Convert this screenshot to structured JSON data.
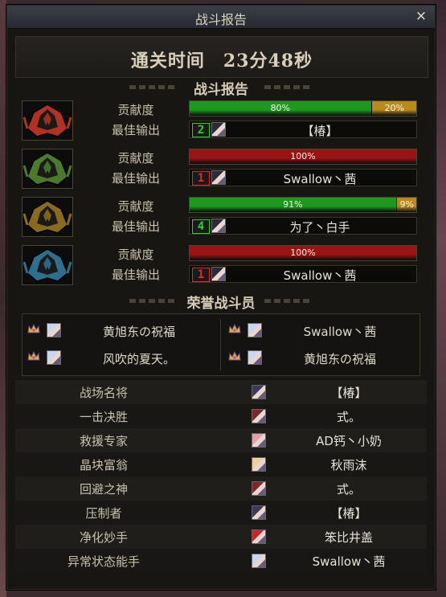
{
  "window": {
    "title": "战斗报告",
    "close_label": "×"
  },
  "clear_time": "通关时间　23分48秒",
  "section_report": "战斗报告",
  "section_honor": "荣誉战斗员",
  "labels": {
    "contribution": "贡献度",
    "best_output": "最佳输出"
  },
  "bosses": [
    {
      "icon": "boss-red-icon",
      "color": "#b03222",
      "segments": [
        {
          "pct": 80,
          "label": "80%",
          "color": "#1d9a1d"
        },
        {
          "pct": 20,
          "label": "20%",
          "color": "#b98a1c"
        }
      ],
      "mvp": {
        "rank": "2",
        "rank_color": "#2ed12e",
        "name": "【椿】"
      }
    },
    {
      "icon": "boss-green-icon",
      "color": "#4a7a2a",
      "segments": [
        {
          "pct": 100,
          "label": "100%",
          "color": "#9a1414"
        }
      ],
      "mvp": {
        "rank": "1",
        "rank_color": "#e22a2a",
        "name": "Swallow丶茜"
      }
    },
    {
      "icon": "boss-gold-icon",
      "color": "#8a6a1e",
      "segments": [
        {
          "pct": 91,
          "label": "91%",
          "color": "#1d9a1d"
        },
        {
          "pct": 9,
          "label": "9%",
          "color": "#b98a1c"
        }
      ],
      "mvp": {
        "rank": "4",
        "rank_color": "#2ed12e",
        "name": "为了丶白手"
      }
    },
    {
      "icon": "boss-blue-icon",
      "color": "#2e6f8e",
      "segments": [
        {
          "pct": 100,
          "label": "100%",
          "color": "#9a1414"
        }
      ],
      "mvp": {
        "rank": "1",
        "rank_color": "#e22a2a",
        "name": "Swallow丶茜"
      }
    }
  ],
  "honor": [
    {
      "name": "黄旭东の祝福",
      "crown": "crown-icon"
    },
    {
      "name": "Swallow丶茜",
      "crown": "crown-icon"
    },
    {
      "name": "风吹的夏天。",
      "crown": "crown-icon"
    },
    {
      "name": "黄旭东の祝福",
      "crown": "crown-icon"
    }
  ],
  "awards": [
    {
      "title": "战场名将",
      "winner": "【椿】"
    },
    {
      "title": "一击决胜",
      "winner": "式。"
    },
    {
      "title": "救援专家",
      "winner": "AD钙丶小奶"
    },
    {
      "title": "晶块富翁",
      "winner": "秋雨沫"
    },
    {
      "title": "回避之神",
      "winner": "式。"
    },
    {
      "title": "压制者",
      "winner": "【椿】"
    },
    {
      "title": "净化妙手",
      "winner": "笨比井盖"
    },
    {
      "title": "异常状态能手",
      "winner": "Swallow丶茜"
    }
  ]
}
